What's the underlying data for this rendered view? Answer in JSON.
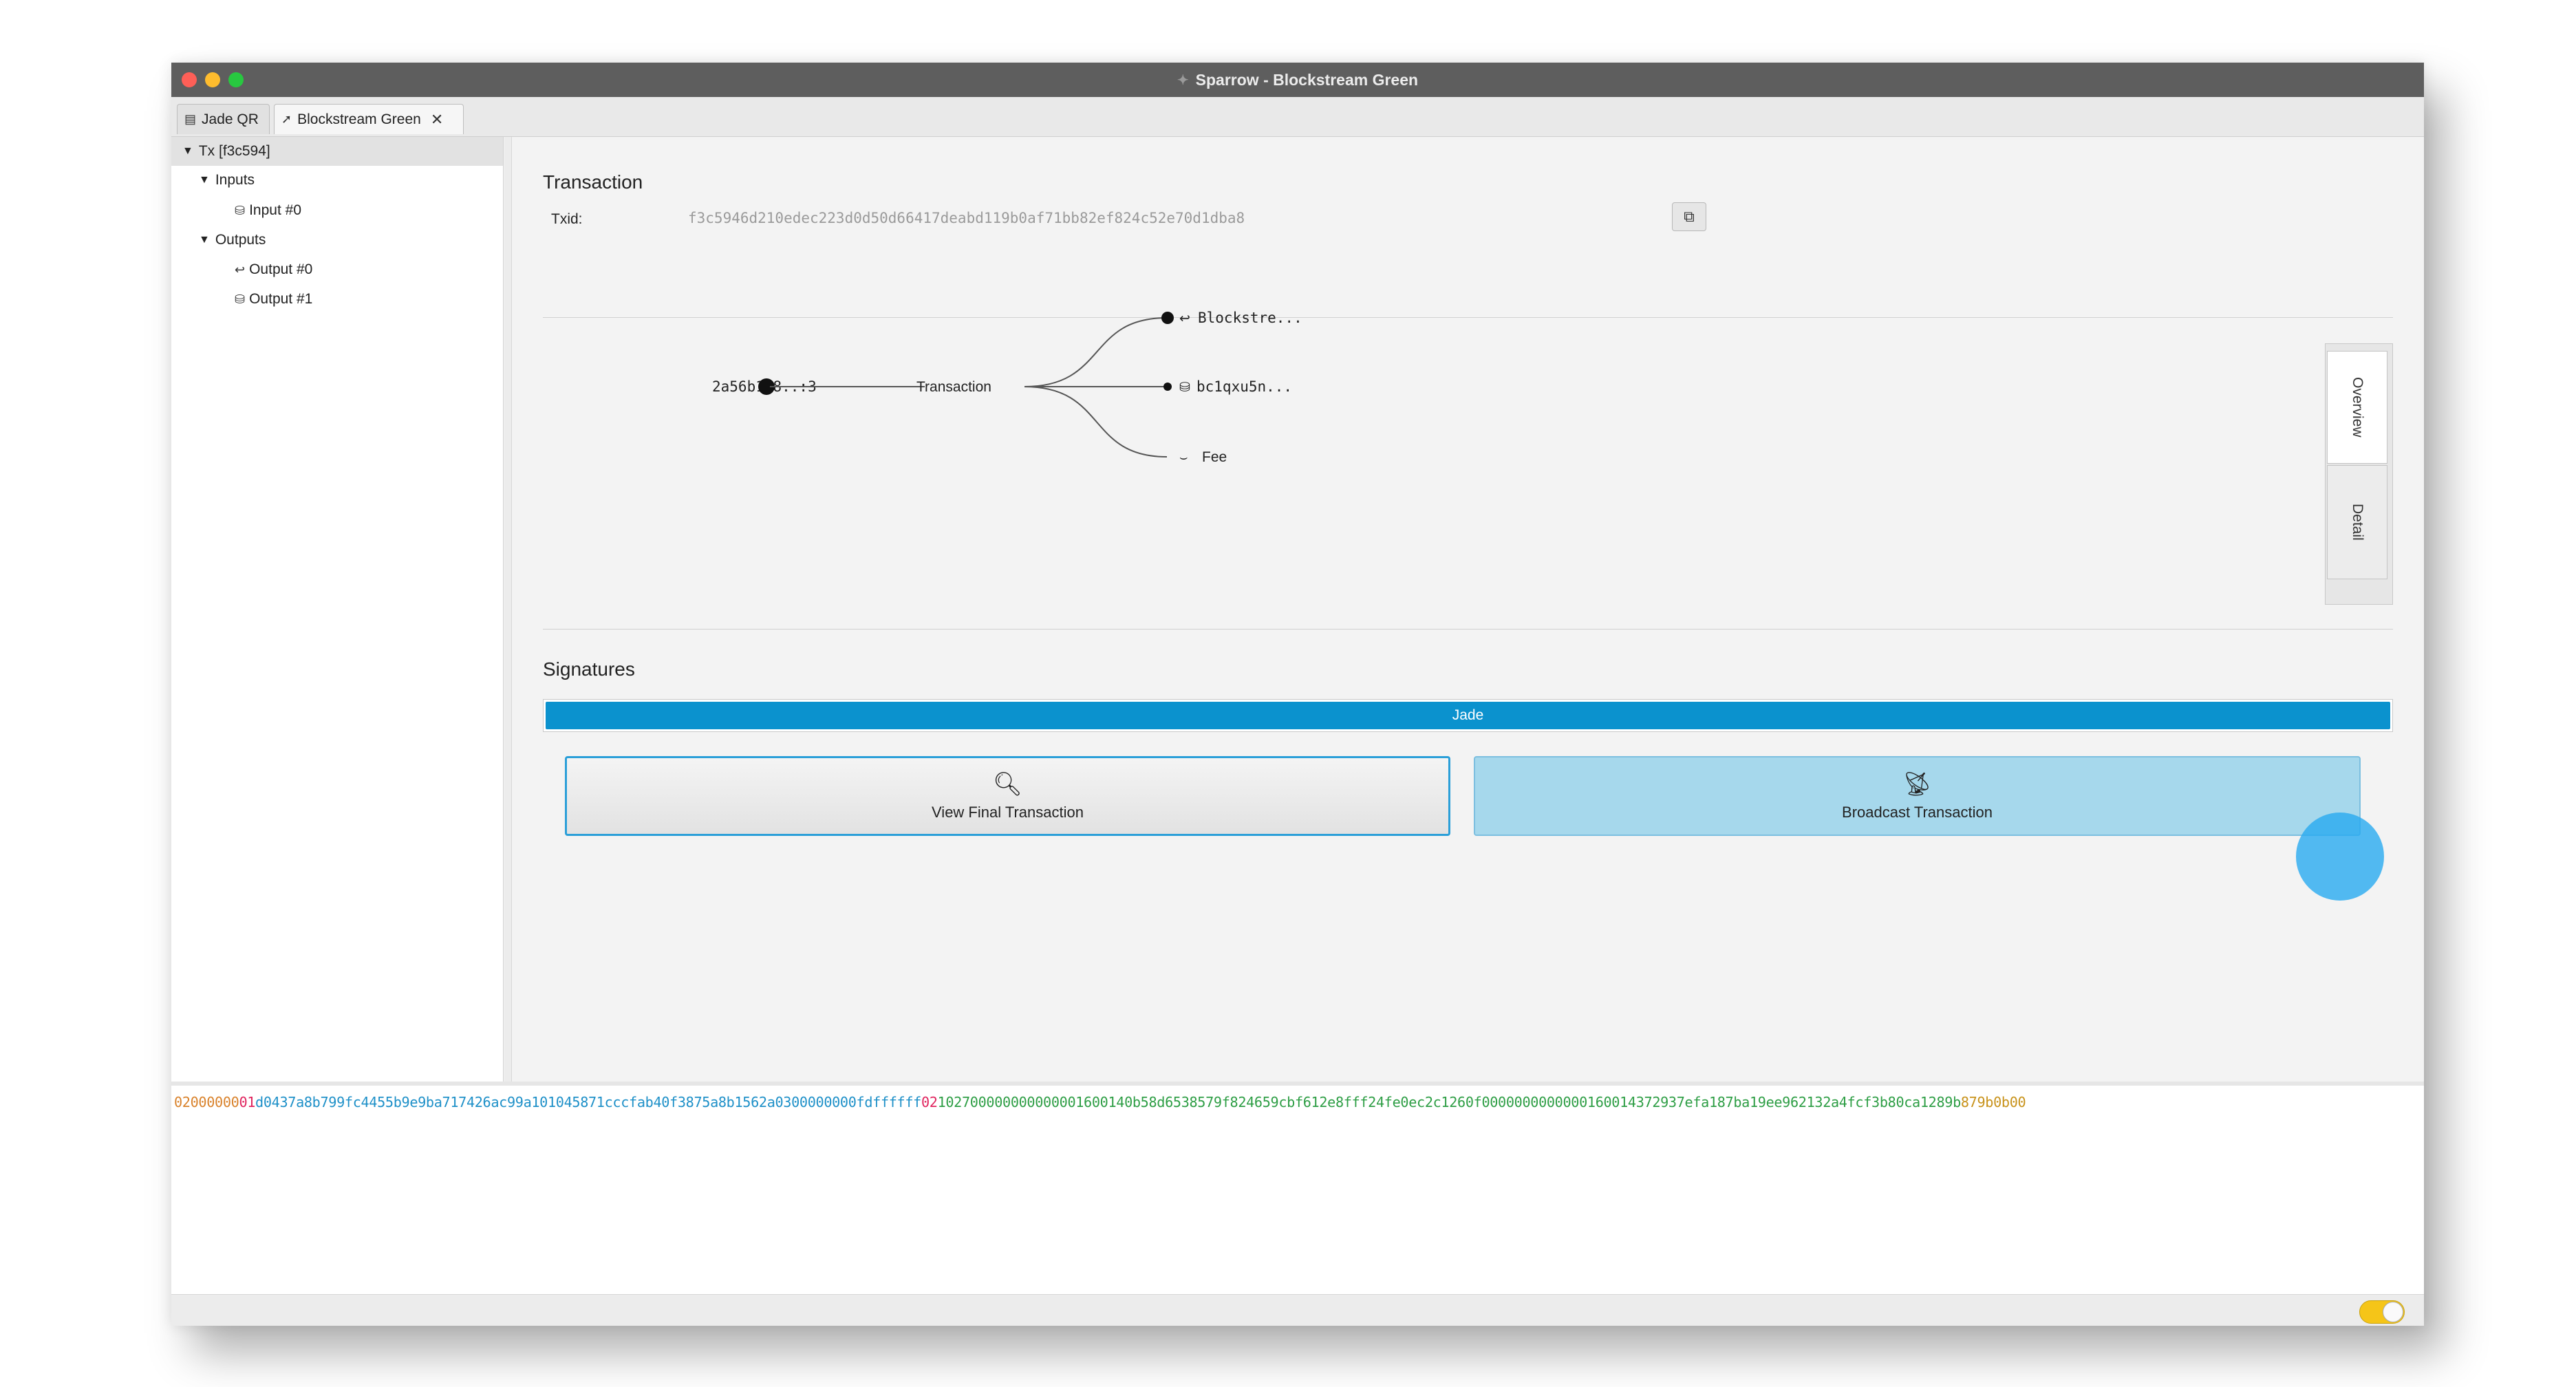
{
  "window": {
    "title": "Sparrow - Blockstream Green",
    "app_icon": "sparrow-icon"
  },
  "tabs": [
    {
      "label": "Jade QR",
      "icon": "wallet-icon"
    },
    {
      "label": "Blockstream Green",
      "icon": "send-icon",
      "closable": true,
      "active": true
    }
  ],
  "tree": {
    "root": "Tx [f3c594]",
    "inputs_label": "Inputs",
    "input0": "Input #0",
    "outputs_label": "Outputs",
    "output0": "Output #0",
    "output1": "Output #1"
  },
  "transaction": {
    "heading": "Transaction",
    "txid_label": "Txid:",
    "txid": "f3c5946d210edec223d0d50d66417deabd119b0af71bb82ef824c52e70d1dba8"
  },
  "graph": {
    "input": "2a56b1a8..:3",
    "center": "Transaction",
    "outputs": [
      "Blockstre...",
      "bc1qxu5n...",
      "Fee"
    ]
  },
  "side_tabs": [
    "Overview",
    "Detail"
  ],
  "signatures": {
    "heading": "Signatures",
    "signer": "Jade",
    "progress": 1.0
  },
  "buttons": {
    "view": "View Final Transaction",
    "broadcast": "Broadcast Transaction"
  },
  "hex": {
    "version": "02000000",
    "input_count": "01",
    "inputs": "d0437a8b799fc4455b9e9ba717426ac99a101045871cccfab40f3875a8b1562a0300000000fdffffff",
    "output_count": "02",
    "outputs": "102700000000000001600140b58d6538579f824659cbf612e8fff24fe0ec2c1260f0000000000000160014372937efa187ba19ee962132a4fcf3b80ca1289b",
    "locktime": "879b0b00"
  },
  "colors": {
    "accent": "#0b92ce",
    "hex_version": "#d9822b",
    "hex_count": "#e0245e",
    "hex_inputs": "#1e90c8",
    "hex_outputs": "#2e9e45",
    "hex_locktime": "#c8921a"
  }
}
